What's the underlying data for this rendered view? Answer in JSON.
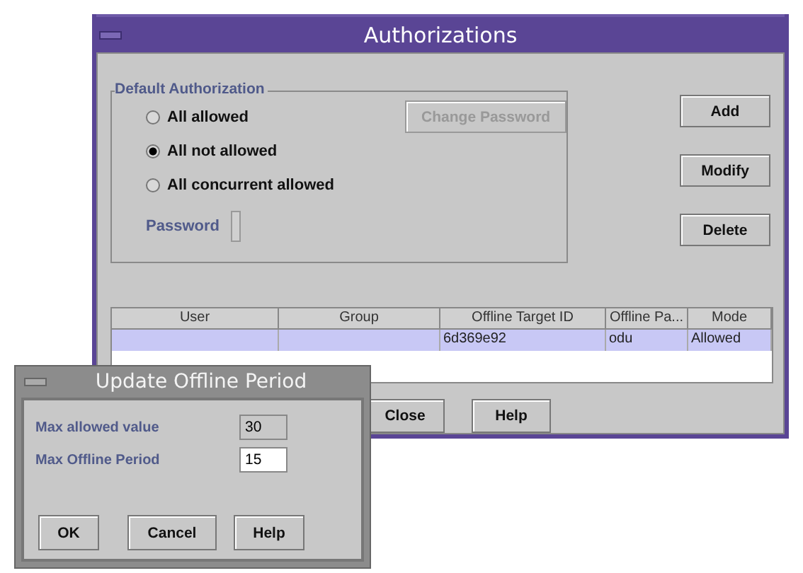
{
  "main_window": {
    "title": "Authorizations",
    "default_authorization": {
      "title": "Default Authorization",
      "options": [
        {
          "label": "All allowed",
          "selected": false
        },
        {
          "label": "All not allowed",
          "selected": true
        },
        {
          "label": "All concurrent allowed",
          "selected": false
        }
      ],
      "change_password": {
        "label": "Change Password",
        "disabled": true
      },
      "password_label": "Password"
    },
    "side_buttons": [
      "Add",
      "Modify",
      "Delete"
    ],
    "table": {
      "columns": [
        "User",
        "Group",
        "Offline Target ID",
        "Offline Pa...",
        "Mode"
      ],
      "rows": [
        {
          "cells": [
            "",
            "",
            "6d369e92",
            "odu",
            "Allowed"
          ],
          "selected": true
        }
      ]
    },
    "bottom_buttons": [
      "Close",
      "Help"
    ]
  },
  "dialog": {
    "title": "Update Offline Period",
    "fields": [
      {
        "label": "Max allowed value",
        "value": "30",
        "editable": false
      },
      {
        "label": "Max Offline Period",
        "value": "15",
        "editable": true
      }
    ],
    "buttons": [
      "OK",
      "Cancel",
      "Help"
    ]
  }
}
